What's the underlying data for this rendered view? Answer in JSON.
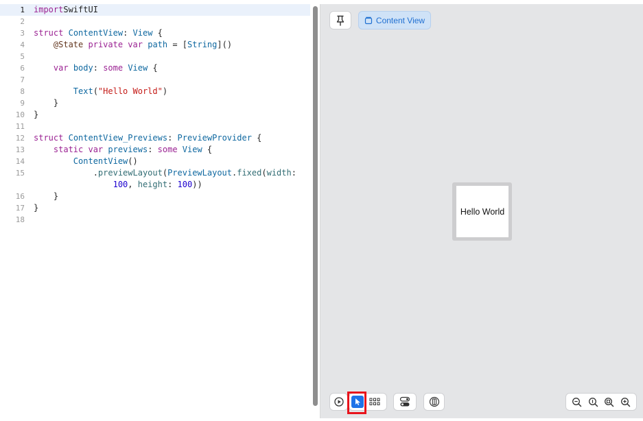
{
  "editor": {
    "lines": [
      {
        "n": "1",
        "parts": [
          [
            "kw",
            "import"
          ],
          [
            "",
            "SwiftUI"
          ]
        ]
      },
      {
        "n": "2",
        "parts": []
      },
      {
        "n": "3",
        "parts": [
          [
            "kw",
            "struct"
          ],
          [
            "",
            " "
          ],
          [
            "ty",
            "ContentView"
          ],
          [
            "",
            ": "
          ],
          [
            "ty",
            "View"
          ],
          [
            "",
            " {"
          ]
        ]
      },
      {
        "n": "4",
        "parts": [
          [
            "",
            "    "
          ],
          [
            "at",
            "@State"
          ],
          [
            "",
            " "
          ],
          [
            "kw",
            "private var"
          ],
          [
            "",
            " "
          ],
          [
            "ty",
            "path"
          ],
          [
            "",
            " = ["
          ],
          [
            "ty",
            "String"
          ],
          [
            "",
            "]()"
          ]
        ]
      },
      {
        "n": "5",
        "parts": []
      },
      {
        "n": "6",
        "parts": [
          [
            "",
            "    "
          ],
          [
            "kw",
            "var"
          ],
          [
            "",
            " "
          ],
          [
            "ty",
            "body"
          ],
          [
            "",
            ": "
          ],
          [
            "kw",
            "some"
          ],
          [
            "",
            " "
          ],
          [
            "ty",
            "View"
          ],
          [
            "",
            " {"
          ]
        ]
      },
      {
        "n": "7",
        "parts": []
      },
      {
        "n": "8",
        "parts": [
          [
            "",
            "        "
          ],
          [
            "ty",
            "Text"
          ],
          [
            "",
            "("
          ],
          [
            "str",
            "\"Hello World\""
          ],
          [
            "",
            ")"
          ]
        ]
      },
      {
        "n": "9",
        "parts": [
          [
            "",
            "    }"
          ]
        ]
      },
      {
        "n": "10",
        "parts": [
          [
            "",
            "}"
          ]
        ]
      },
      {
        "n": "11",
        "parts": []
      },
      {
        "n": "12",
        "parts": [
          [
            "kw",
            "struct"
          ],
          [
            "",
            " "
          ],
          [
            "ty",
            "ContentView_Previews"
          ],
          [
            "",
            ": "
          ],
          [
            "ty",
            "PreviewProvider"
          ],
          [
            "",
            " {"
          ]
        ]
      },
      {
        "n": "13",
        "parts": [
          [
            "",
            "    "
          ],
          [
            "kw",
            "static var"
          ],
          [
            "",
            " "
          ],
          [
            "ty",
            "previews"
          ],
          [
            "",
            ": "
          ],
          [
            "kw",
            "some"
          ],
          [
            "",
            " "
          ],
          [
            "ty",
            "View"
          ],
          [
            "",
            " {"
          ]
        ]
      },
      {
        "n": "14",
        "parts": [
          [
            "",
            "        "
          ],
          [
            "ty",
            "ContentView"
          ],
          [
            "",
            "()"
          ]
        ]
      },
      {
        "n": "15",
        "parts": [
          [
            "",
            "            ."
          ],
          [
            "fn",
            "previewLayout"
          ],
          [
            "",
            "("
          ],
          [
            "ty",
            "PreviewLayout"
          ],
          [
            "",
            "."
          ],
          [
            "fn",
            "fixed"
          ],
          [
            "",
            "("
          ],
          [
            "fn",
            "width"
          ],
          [
            "",
            ":"
          ]
        ]
      },
      {
        "n": "",
        "parts": [
          [
            "",
            "                "
          ],
          [
            "num",
            "100"
          ],
          [
            "",
            ", "
          ],
          [
            "fn",
            "height"
          ],
          [
            "",
            ": "
          ],
          [
            "num",
            "100"
          ],
          [
            "",
            "))"
          ]
        ]
      },
      {
        "n": "16",
        "parts": [
          [
            "",
            "    }"
          ]
        ]
      },
      {
        "n": "17",
        "parts": [
          [
            "",
            "}"
          ]
        ]
      },
      {
        "n": "18",
        "parts": []
      }
    ]
  },
  "canvas": {
    "content_view_label": "Content View",
    "preview_text": "Hello World"
  },
  "icons": {
    "pin": "pin-icon",
    "content_view": "cube-icon",
    "live": "play-icon",
    "select": "cursor-icon",
    "grid": "grid-icon",
    "variants": "toggle-icon",
    "device": "device-settings-icon",
    "zoom": [
      "zoom-out-icon",
      "zoom-actual-icon",
      "zoom-fit-icon",
      "zoom-in-icon"
    ]
  },
  "colors": {
    "accent": "#1f73e8",
    "highlight": "#e8131b",
    "keyword": "#9b2393",
    "type": "#0f68a0",
    "string": "#c41a16",
    "number": "#1c00cf"
  }
}
